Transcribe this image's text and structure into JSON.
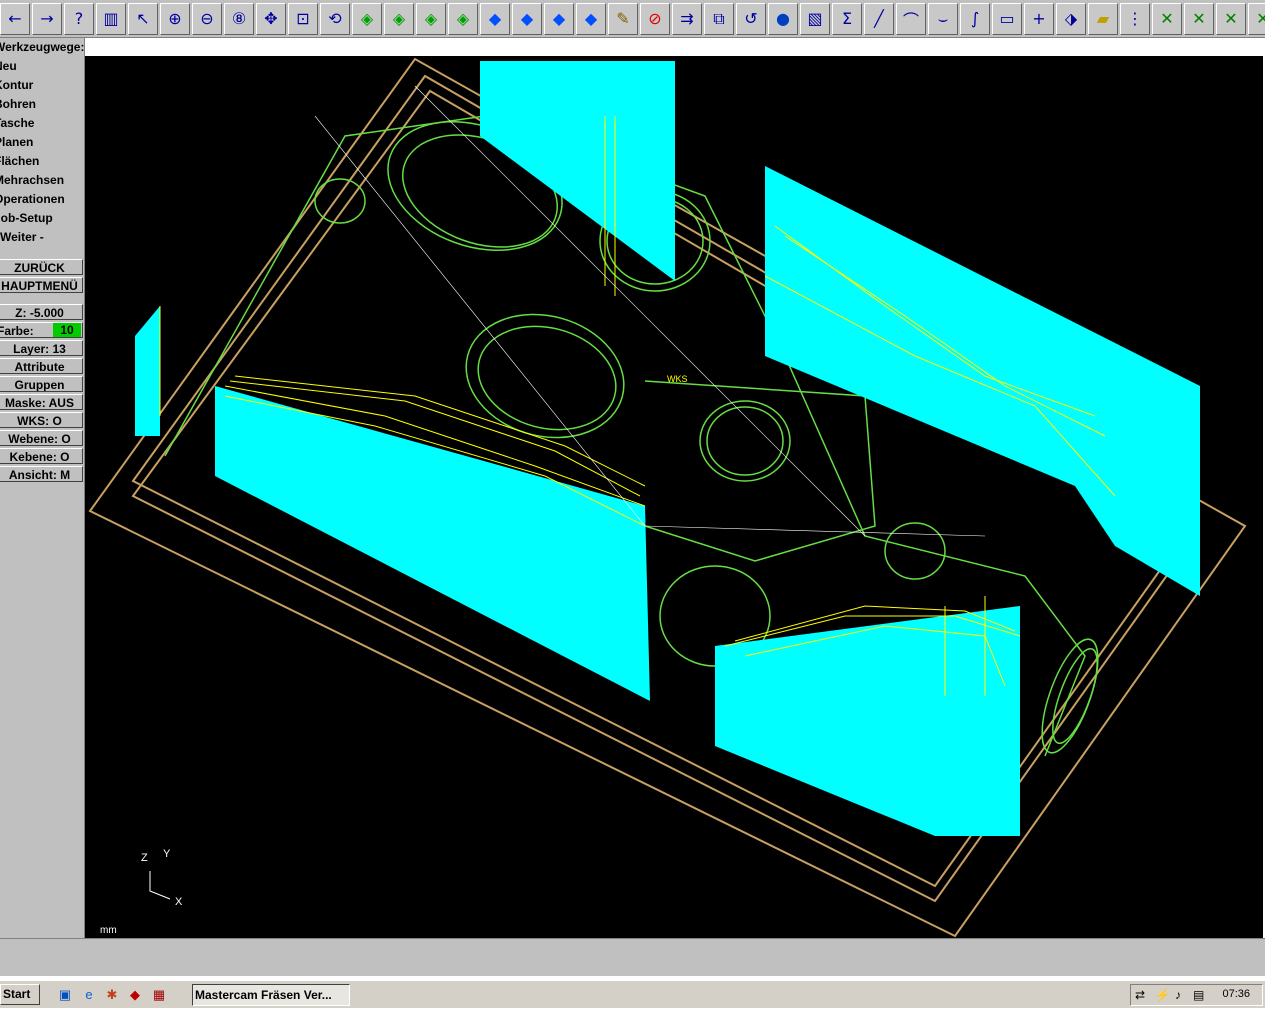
{
  "toolbar": {
    "icons": [
      "arrow-left-icon",
      "arrow-right-icon",
      "help-icon",
      "memory-icon",
      "analyze-icon",
      "zoom-in-icon",
      "zoom-out-icon",
      "zoom-8-icon",
      "pan-icon",
      "zoom-window-icon",
      "rotate-view-icon",
      "cube-top-icon",
      "cube-front-icon",
      "cube-side-icon",
      "cube-iso-icon",
      "cube-blue-1-icon",
      "cube-blue-2-icon",
      "cube-blue-3-icon",
      "cube-blue-4-icon",
      "pencil-icon",
      "no-entry-icon",
      "transform-icon",
      "color-transform-icon",
      "undo-icon",
      "sphere-icon",
      "layers-icon",
      "sigma-icon",
      "line-icon",
      "arc-icon",
      "fillet-icon",
      "spline-icon",
      "rectangle-icon",
      "point-icon",
      "surface-icon",
      "solid-icon",
      "tree-icon",
      "trim-1-icon",
      "trim-2-icon",
      "trim-3-icon",
      "trim-4-icon"
    ]
  },
  "menu": {
    "title": "Werkzeugwege:",
    "items": [
      "Neu",
      "Kontur",
      "Bohren",
      "Tasche",
      "Planen",
      "Flächen",
      "Mehrachsen",
      "Operationen",
      "Job-Setup",
      "Weiter -"
    ],
    "back_button": "ZURÜCK",
    "main_button": "HAUPTMENÜ",
    "z_field": "Z:  -5.000",
    "farbe_label": "Farbe:",
    "farbe_value": "10",
    "layer_button": "Layer: 13",
    "attribute_button": "Attribute",
    "gruppen_button": "Gruppen",
    "maske_button": "Maske: AUS",
    "wks_button": "WKS:    O",
    "webene_button": "Webene:   O",
    "kebene_button": "Kebene:   O",
    "ansicht_button": "Ansicht:   M"
  },
  "viewport": {
    "unit": "mm",
    "axis_z": "Z",
    "axis_y": "Y",
    "axis_x": "X",
    "wks_label": "WKS",
    "colors": {
      "background": "#000000",
      "toolpath_cyan": "#00ffff",
      "toolpath_yellow": "#ffff00",
      "geometry_green": "#66dd44",
      "stock": "#c8a060"
    }
  },
  "taskbar": {
    "start_label": "Start",
    "task_label": "Mastercam Fräsen Ver...",
    "clock": "07:36"
  }
}
